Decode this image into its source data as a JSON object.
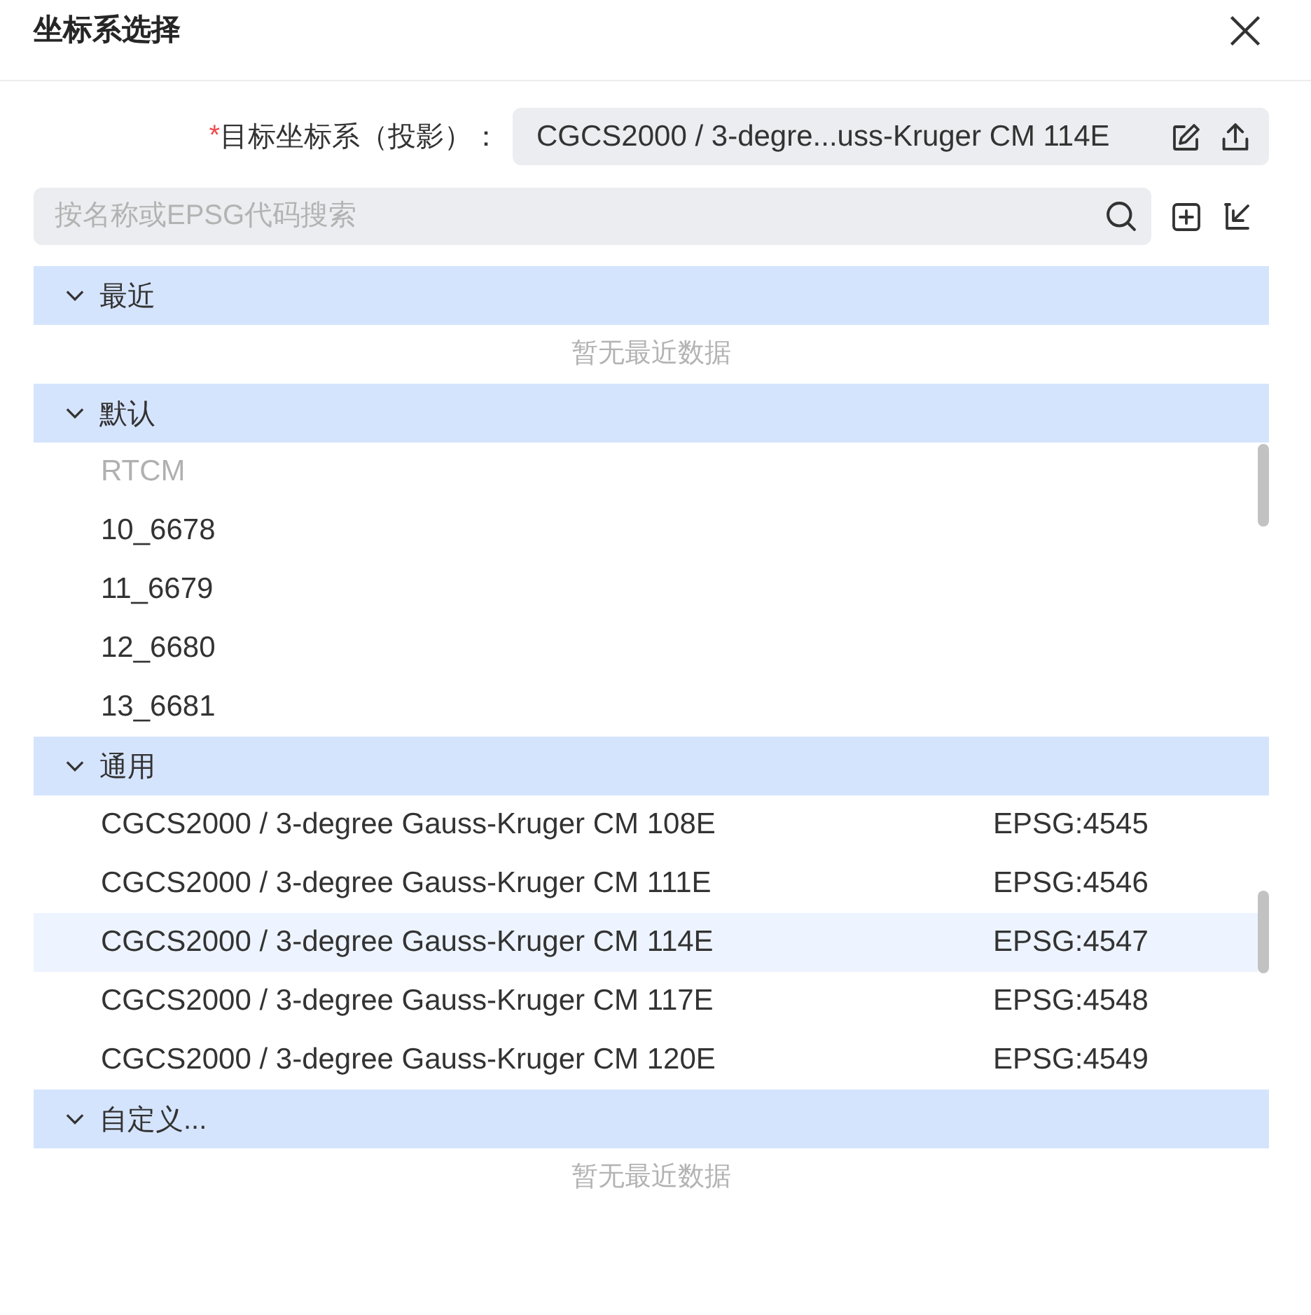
{
  "dialog": {
    "title": "坐标系选择"
  },
  "target": {
    "required_mark": "*",
    "label": "目标坐标系（投影）：",
    "value": "CGCS2000 / 3-degre...uss-Kruger CM 114E"
  },
  "search": {
    "placeholder": "按名称或EPSG代码搜索"
  },
  "groups": [
    {
      "title": "最近",
      "expanded": true,
      "empty_text": "暂无最近数据"
    },
    {
      "title": "默认",
      "expanded": true,
      "scrollable": true,
      "items": [
        {
          "name": "RTCM",
          "disabled": true,
          "selected": false
        },
        {
          "name": "10_6678",
          "disabled": false,
          "selected": false
        },
        {
          "name": "11_6679",
          "disabled": false,
          "selected": false
        },
        {
          "name": "12_6680",
          "disabled": false,
          "selected": false
        },
        {
          "name": "13_6681",
          "disabled": false,
          "selected": false
        }
      ]
    },
    {
      "title": "通用",
      "expanded": true,
      "scrollable": true,
      "items": [
        {
          "name": "CGCS2000 / 3-degree Gauss-Kruger CM 108E",
          "code": "EPSG:4545",
          "disabled": false,
          "selected": false
        },
        {
          "name": "CGCS2000 / 3-degree Gauss-Kruger CM 111E",
          "code": "EPSG:4546",
          "disabled": false,
          "selected": false
        },
        {
          "name": "CGCS2000 / 3-degree Gauss-Kruger CM 114E",
          "code": "EPSG:4547",
          "disabled": false,
          "selected": true
        },
        {
          "name": "CGCS2000 / 3-degree Gauss-Kruger CM 117E",
          "code": "EPSG:4548",
          "disabled": false,
          "selected": false
        },
        {
          "name": "CGCS2000 / 3-degree Gauss-Kruger CM 120E",
          "code": "EPSG:4549",
          "disabled": false,
          "selected": false
        }
      ]
    },
    {
      "title": "自定义...",
      "expanded": true,
      "empty_text": "暂无最近数据"
    }
  ]
}
